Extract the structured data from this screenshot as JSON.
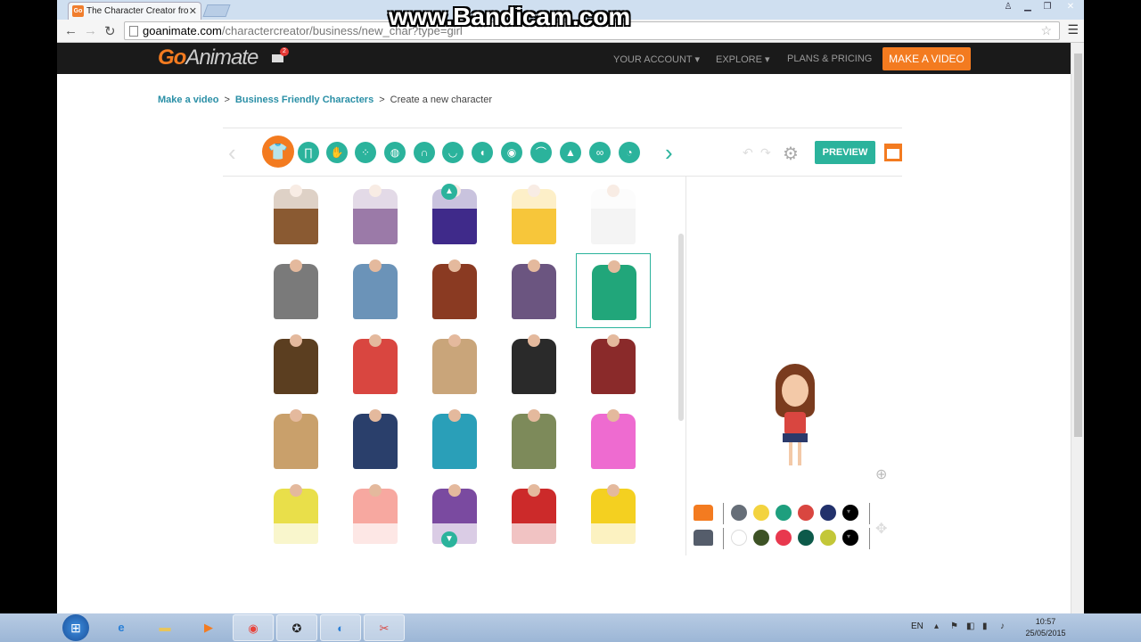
{
  "watermark": "www.Bandicam.com",
  "browser": {
    "tab_title": "The Character Creator fro",
    "tab_icon_text": "Go",
    "url_host": "goanimate.com",
    "url_path": "/charactercreator/business/new_char?type=girl"
  },
  "site": {
    "logo_go": "Go",
    "logo_animate": "Animate",
    "mail_badge": "2",
    "nav": {
      "account": "YOUR ACCOUNT ▾",
      "explore": "EXPLORE ▾",
      "plans": "PLANS & PRICING",
      "make_video": "MAKE A VIDEO"
    }
  },
  "breadcrumb": {
    "item1": "Make a video",
    "sep": ">",
    "item2": "Business Friendly Characters",
    "current": "Create a new character"
  },
  "toolbar": {
    "categories": [
      "upper-body",
      "lower-body",
      "hand",
      "footwear",
      "face-shape",
      "hair",
      "mouth",
      "ear",
      "eye",
      "eyebrow",
      "nose",
      "glasses",
      "facial-hair"
    ],
    "preview_label": "PREVIEW"
  },
  "grid": {
    "rows": [
      [
        "#8a5a32",
        "#9b7aa8",
        "#3f2a8a",
        "#f7c63a",
        "#f4f4f4"
      ],
      [
        "#7a7a7a",
        "#6b93b8",
        "#8a3a22",
        "#6b5580",
        "#21a67a"
      ],
      [
        "#5b3e20",
        "#d94640",
        "#c9a57a",
        "#2a2a2a",
        "#8a2a2a"
      ],
      [
        "#c9a06b",
        "#2a3f6b",
        "#2a9fb8",
        "#7d8a5a",
        "#ee6bd0"
      ],
      [
        "#e9df4a",
        "#f7a8a0",
        "#7a4aa0",
        "#cc2a2a",
        "#f4d020"
      ]
    ],
    "selected": [
      1,
      4
    ]
  },
  "palette": {
    "primary": [
      "#666e78",
      "#f3d33f",
      "#1e9f7e",
      "#d94640",
      "#22316b",
      "#000000"
    ],
    "secondary": [
      "#ffffff",
      "#3d5225",
      "#e8384e",
      "#0d5a4a",
      "#c3c738",
      "#000000"
    ]
  },
  "taskbar": {
    "lang": "EN",
    "time": "10:57",
    "date": "25/05/2015"
  }
}
